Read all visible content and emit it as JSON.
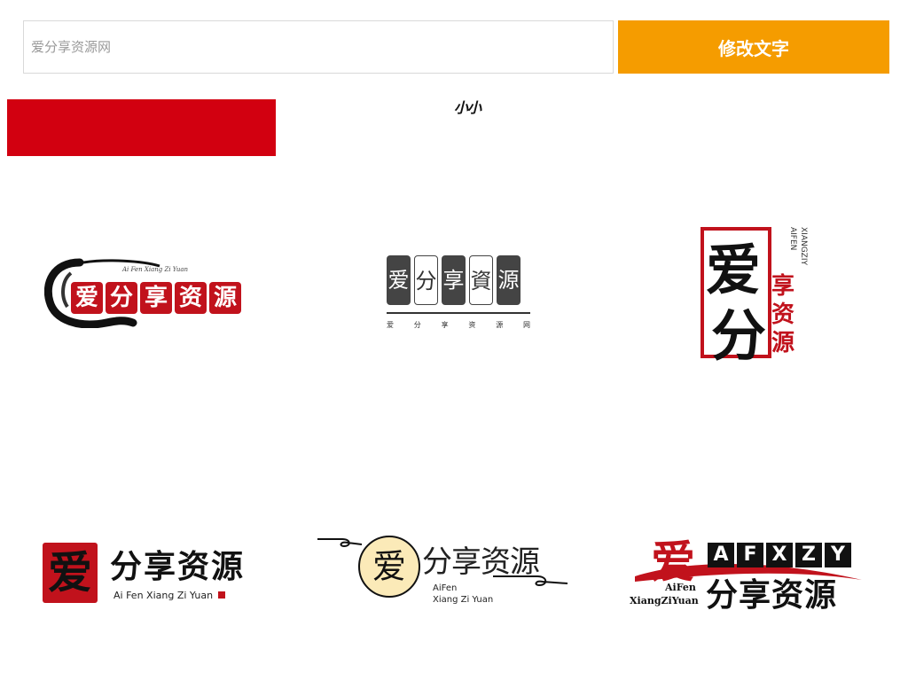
{
  "search": {
    "placeholder": "爱分享资源网",
    "value": ""
  },
  "toolbar": {
    "modify_label": "修改文字"
  },
  "color_swatch": {
    "color": "#d20010"
  },
  "size_label": "小小",
  "colors": {
    "accent": "#f59c00",
    "seal_red": "#c1121c",
    "ink": "#111111"
  },
  "logos": [
    {
      "chars": [
        "爱",
        "分",
        "享",
        "资",
        "源"
      ],
      "subtitle": "Ai Fen Xiang Zi Yuan"
    },
    {
      "chars": [
        "爱",
        "分",
        "享",
        "資",
        "源"
      ],
      "subtitle_chars": [
        "爱",
        "分",
        "享",
        "资",
        "源",
        "网"
      ]
    },
    {
      "main_top": "爱",
      "main_bottom": "分",
      "side_chars": [
        "享",
        "资",
        "源"
      ],
      "vertical_lines": [
        "XIANGZIY",
        "AIFEN"
      ]
    },
    {
      "seal_char": "爱",
      "main": "分享资源",
      "subtitle": "Ai Fen Xiang Zi Yuan"
    },
    {
      "circle_char": "爱",
      "main": "分享资源",
      "sub1": "AiFen",
      "sub2": "Xiang Zi Yuan"
    },
    {
      "big_char": "爱",
      "boxes": [
        "A",
        "F",
        "X",
        "Z",
        "Y"
      ],
      "sub1": "AiFen",
      "sub2": "XiangZiYuan",
      "main": "分享资源"
    }
  ]
}
